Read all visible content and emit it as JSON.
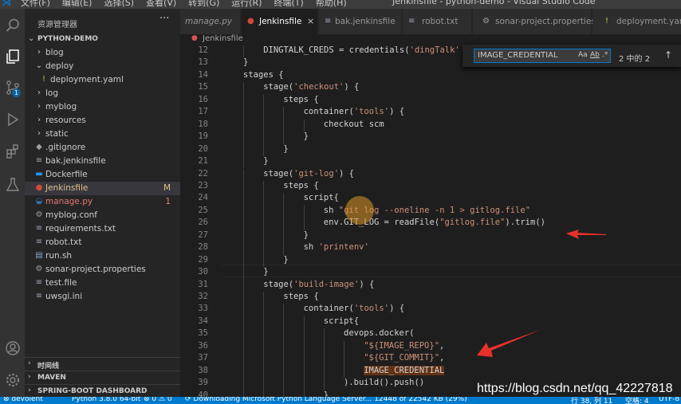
{
  "titlebar": {
    "menu": [
      "文件(F)",
      "编辑(E)",
      "选择(S)",
      "查看(V)",
      "转到(G)",
      "运行(R)",
      "终端(T)",
      "帮助(H)"
    ],
    "title": "Jenkinsfile - python-demo - Visual Studio Code"
  },
  "activity": {
    "source_control_badge": "1"
  },
  "sidebar": {
    "title": "资源管理器",
    "more": "···",
    "project": "PYTHON-DEMO",
    "items": [
      {
        "label": "blog",
        "icon": "chevron-right-icon",
        "kind": "folder"
      },
      {
        "label": "deploy",
        "icon": "chevron-down-icon",
        "kind": "folder"
      },
      {
        "label": "deployment.yaml",
        "icon": "yaml-icon",
        "kind": "file"
      },
      {
        "label": "log",
        "icon": "chevron-right-icon",
        "kind": "folder"
      },
      {
        "label": "myblog",
        "icon": "chevron-right-icon",
        "kind": "folder"
      },
      {
        "label": "resources",
        "icon": "chevron-right-icon",
        "kind": "folder"
      },
      {
        "label": "static",
        "icon": "chevron-right-icon",
        "kind": "folder"
      },
      {
        "label": ".gitignore",
        "icon": "git-icon",
        "kind": "file"
      },
      {
        "label": "bak.jenkinsfile",
        "icon": "file-icon",
        "kind": "file"
      },
      {
        "label": "Dockerfile",
        "icon": "docker-icon",
        "kind": "file"
      },
      {
        "label": "Jenkinsfile",
        "icon": "jenkins-icon",
        "kind": "file",
        "deco": "M"
      },
      {
        "label": "manage.py",
        "icon": "python-icon",
        "kind": "file",
        "deco": "1"
      },
      {
        "label": "myblog.conf",
        "icon": "gear-icon",
        "kind": "file"
      },
      {
        "label": "requirements.txt",
        "icon": "text-icon",
        "kind": "file"
      },
      {
        "label": "robot.txt",
        "icon": "text-icon",
        "kind": "file"
      },
      {
        "label": "run.sh",
        "icon": "shell-icon",
        "kind": "file"
      },
      {
        "label": "sonar-project.properties",
        "icon": "gear-icon",
        "kind": "file"
      },
      {
        "label": "test.file",
        "icon": "text-icon",
        "kind": "file"
      },
      {
        "label": "uwsgi.ini",
        "icon": "text-icon",
        "kind": "file"
      }
    ],
    "panels": [
      "时间线",
      "MAVEN",
      "SPRING-BOOT DASHBOARD"
    ]
  },
  "tabs": [
    {
      "label": "manage.py",
      "icon": "python-icon",
      "active": false
    },
    {
      "label": "Jenkinsfile",
      "icon": "jenkins-icon",
      "active": true,
      "close": "×"
    },
    {
      "label": "bak.jenkinsfile",
      "icon": "file-icon",
      "active": false
    },
    {
      "label": "robot.txt",
      "icon": "text-icon",
      "active": false
    },
    {
      "label": "sonar-project.properties",
      "icon": "gear-icon",
      "active": false
    },
    {
      "label": "deployment.yaml",
      "icon": "yaml-icon",
      "active": false
    }
  ],
  "breadcrumb": "Jenkinsfile",
  "find": {
    "value": "IMAGE_CREDENTIAL",
    "opts": [
      "Aa",
      "Ab",
      ".*"
    ],
    "count": "2 中的 2",
    "up": "↑"
  },
  "editor": {
    "lines": [
      {
        "n": "12",
        "indent": 1,
        "code": "DINGTALK_CREDS = credentials('dingTalk'"
      },
      {
        "n": "13",
        "indent": 0,
        "code": "}"
      },
      {
        "n": "14",
        "indent": 0,
        "code": "stages {"
      },
      {
        "n": "15",
        "indent": 1,
        "code": "stage('checkout') {"
      },
      {
        "n": "16",
        "indent": 2,
        "code": "steps {"
      },
      {
        "n": "17",
        "indent": 3,
        "code": "container('tools') {"
      },
      {
        "n": "18",
        "indent": 4,
        "code": "checkout scm"
      },
      {
        "n": "19",
        "indent": 3,
        "code": "}"
      },
      {
        "n": "20",
        "indent": 2,
        "code": "}"
      },
      {
        "n": "21",
        "indent": 1,
        "code": "}"
      },
      {
        "n": "22",
        "indent": 1,
        "code": "stage('git-log') {"
      },
      {
        "n": "23",
        "indent": 2,
        "code": "steps {"
      },
      {
        "n": "24",
        "indent": 3,
        "code": "script{"
      },
      {
        "n": "25",
        "indent": 4,
        "code": "sh \"git log --oneline -n 1 > gitlog.file\""
      },
      {
        "n": "26",
        "indent": 4,
        "code": "env.GIT_LOG = readFile(\"gitlog.file\").trim()"
      },
      {
        "n": "27",
        "indent": 3,
        "code": "}"
      },
      {
        "n": "28",
        "indent": 3,
        "code": "sh 'printenv'"
      },
      {
        "n": "29",
        "indent": 2,
        "code": "}"
      },
      {
        "n": "30",
        "indent": 1,
        "code": "}"
      },
      {
        "n": "31",
        "indent": 1,
        "code": "stage('build-image') {"
      },
      {
        "n": "32",
        "indent": 2,
        "code": "steps {"
      },
      {
        "n": "33",
        "indent": 3,
        "code": "container('tools') {"
      },
      {
        "n": "34",
        "indent": 4,
        "code": "script{"
      },
      {
        "n": "35",
        "indent": 5,
        "code": "devops.docker("
      },
      {
        "n": "36",
        "indent": 6,
        "code": "\"${IMAGE_REPO}\","
      },
      {
        "n": "37",
        "indent": 6,
        "code": "\"${GIT_COMMIT}\","
      },
      {
        "n": "38",
        "indent": 6,
        "code": "IMAGE_CREDENTIAL",
        "highlight": true
      },
      {
        "n": "39",
        "indent": 5,
        "code": ").build().push()"
      },
      {
        "n": "40",
        "indent": 4,
        "code": "}"
      }
    ]
  },
  "status": {
    "left": [
      "⊗ devolent",
      "Python 3.8.0 64-bit",
      "⊗ 0 ⚠ 0",
      "⟳ Downloading Microsoft Python Language Server... 12448 of 22542 KB (29%)"
    ],
    "right": [
      "行 38, 列 11",
      "空格: 4",
      "UTF-8"
    ]
  },
  "watermark": "https://blog.csdn.net/qq_42227818",
  "colors": {
    "accent": "#007acc",
    "highlight": "#613214",
    "arrow": "#e8302a"
  }
}
